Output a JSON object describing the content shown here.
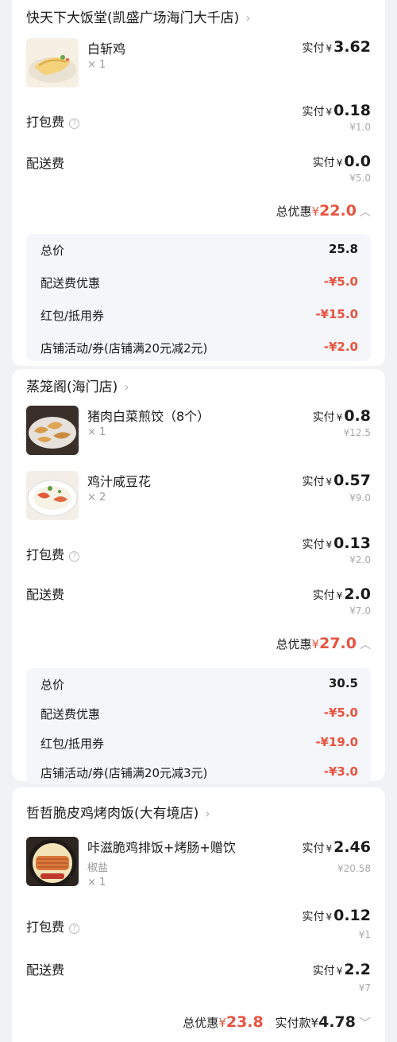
{
  "stores": [
    {
      "name": "快天下大饭堂(凯盛广场海门大千店)",
      "items": [
        {
          "name": "白斩鸡",
          "qty": "× 1",
          "pay_label": "实付",
          "currency": "¥",
          "pay": "3.62"
        }
      ],
      "packing": {
        "label": "打包费",
        "pay_label": "实付",
        "currency": "¥",
        "pay": "0.18",
        "original": "¥1.0"
      },
      "delivery": {
        "label": "配送费",
        "pay_label": "实付",
        "currency": "¥",
        "pay": "0.0",
        "original": "¥5.0"
      },
      "discount_total": {
        "label": "总优惠",
        "currency": "¥",
        "value": "22.0"
      },
      "summary": [
        {
          "label": "总价",
          "value": "25.8"
        },
        {
          "label": "配送费优惠",
          "value": "-¥5.0"
        },
        {
          "label": "红包/抵用券",
          "value": "-¥15.0"
        },
        {
          "label": "店铺活动/券(店铺满20元减2元)",
          "value": "-¥2.0"
        }
      ]
    },
    {
      "name": "蒸笼阁(海门店)",
      "items": [
        {
          "name": "猪肉白菜煎饺（8个）",
          "qty": "× 1",
          "pay_label": "实付",
          "currency": "¥",
          "pay": "0.8",
          "original": "¥12.5"
        },
        {
          "name": "鸡汁咸豆花",
          "qty": "× 2",
          "pay_label": "实付",
          "currency": "¥",
          "pay": "0.57",
          "original": "¥9.0"
        }
      ],
      "packing": {
        "label": "打包费",
        "pay_label": "实付",
        "currency": "¥",
        "pay": "0.13",
        "original": "¥2.0"
      },
      "delivery": {
        "label": "配送费",
        "pay_label": "实付",
        "currency": "¥",
        "pay": "2.0",
        "original": "¥7.0"
      },
      "discount_total": {
        "label": "总优惠",
        "currency": "¥",
        "value": "27.0"
      },
      "summary": [
        {
          "label": "总价",
          "value": "30.5"
        },
        {
          "label": "配送费优惠",
          "value": "-¥5.0"
        },
        {
          "label": "红包/抵用券",
          "value": "-¥19.0"
        },
        {
          "label": "店铺活动/券(店铺满20元减3元)",
          "value": "-¥3.0"
        }
      ]
    },
    {
      "name": "哲哲脆皮鸡烤肉饭(大有境店)",
      "items": [
        {
          "name": "咔滋脆鸡排饭+烤肠+赠饮",
          "spec": "椒盐",
          "qty": "× 1",
          "pay_label": "实付",
          "currency": "¥",
          "pay": "2.46",
          "original": "¥20.58"
        }
      ],
      "packing": {
        "label": "打包费",
        "pay_label": "实付",
        "currency": "¥",
        "pay": "0.12",
        "original": "¥1"
      },
      "delivery": {
        "label": "配送费",
        "pay_label": "实付",
        "currency": "¥",
        "pay": "2.2",
        "original": "¥7"
      },
      "footer": {
        "discount_label": "总优惠",
        "discount_currency": "¥",
        "discount_value": "23.8",
        "paid_label": "实付款",
        "paid_currency": "¥",
        "paid_value": "4.78"
      }
    }
  ],
  "icons": {
    "chevron": "chevron-right-icon",
    "help": "help-icon",
    "collapse": "chevron-up-icon",
    "expand": "chevron-down-icon"
  },
  "colors": {
    "accent_red": "#e8533f",
    "page_bg": "#f1f2f4",
    "summary_bg": "#f4f6fa"
  }
}
